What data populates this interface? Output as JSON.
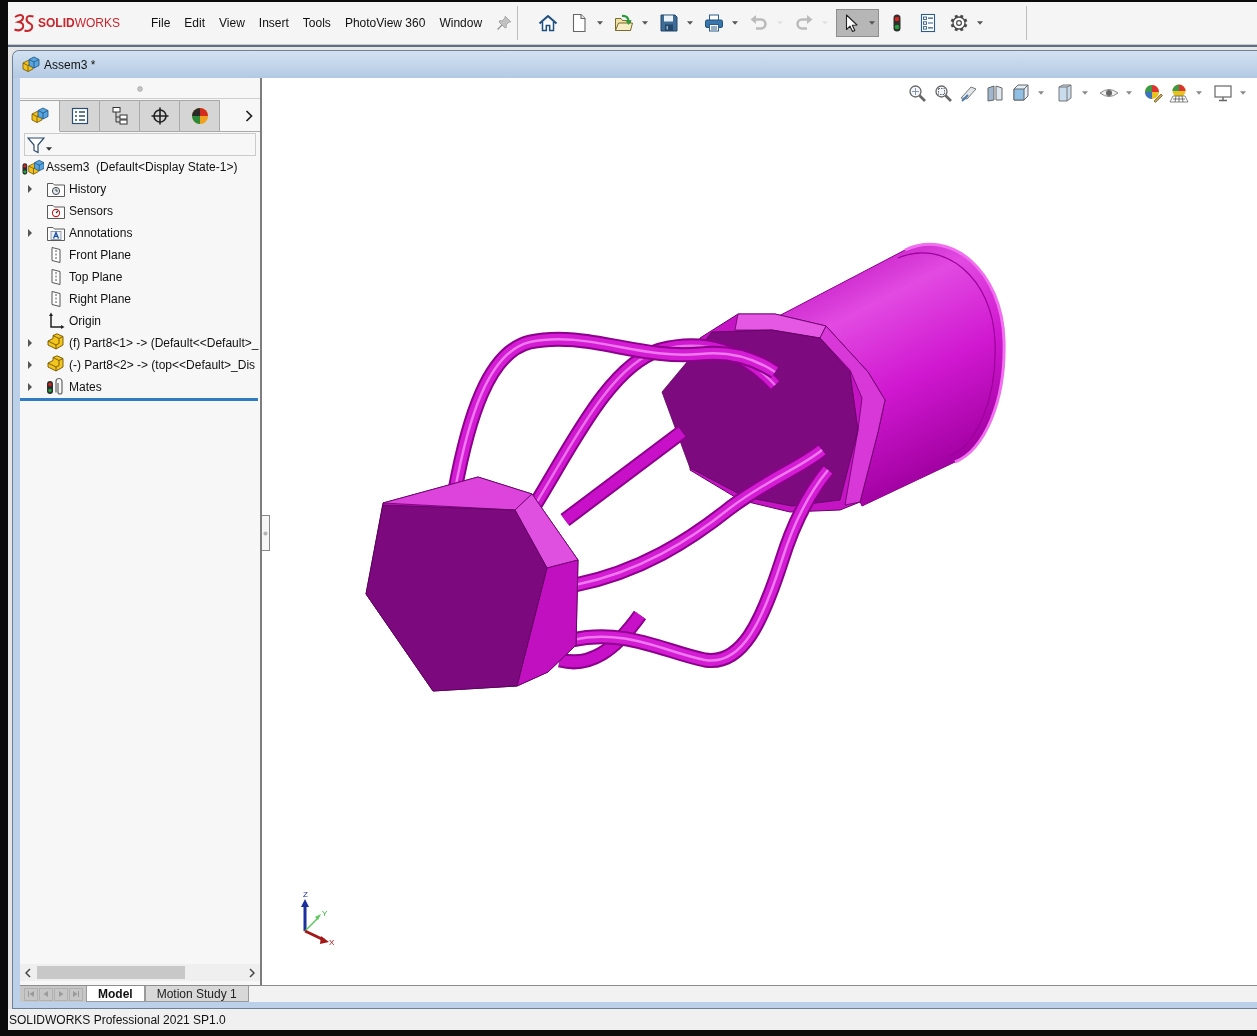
{
  "menubar": {
    "logo": "**SOLID**WORKS",
    "menu": [
      "File",
      "Edit",
      "View",
      "Insert",
      "Tools",
      "PhotoView 360",
      "Window"
    ]
  },
  "toolbar": [
    {
      "dropdown": false,
      "disabled": false,
      "selected": false
    },
    {
      "dropdown": true,
      "disabled": false,
      "selected": false
    },
    {
      "dropdown": true,
      "disabled": false,
      "selected": false
    },
    {
      "dropdown": true,
      "disabled": false,
      "selected": false
    },
    {
      "dropdown": true,
      "disabled": false,
      "selected": false
    },
    {
      "dropdown": true,
      "disabled": true,
      "selected": false
    },
    {
      "dropdown": true,
      "disabled": true,
      "selected": false
    },
    {
      "dropdown": true,
      "disabled": false,
      "selected": true
    },
    {
      "dropdown": false,
      "disabled": false,
      "selected": false
    },
    {
      "dropdown": false,
      "disabled": false,
      "selected": false
    },
    {
      "dropdown": true,
      "disabled": false,
      "selected": false
    }
  ],
  "document": {
    "title": "Assem3 *"
  },
  "feature_panel": {
    "tabs": [
      {
        "selected": true
      },
      {
        "selected": false
      },
      {
        "selected": false
      },
      {
        "selected": false
      },
      {
        "selected": false
      }
    ],
    "tree": {
      "label": "Assem3  (Default<Display State-1>)",
      "kind": "assembly",
      "children": [
        {
          "label": "History",
          "kind": "history",
          "expandable": true,
          "expanded": false
        },
        {
          "label": "Sensors",
          "kind": "sensors",
          "expandable": false
        },
        {
          "label": "Annotations",
          "kind": "annotations",
          "expandable": true,
          "expanded": false
        },
        {
          "label": "Front Plane",
          "kind": "plane",
          "expandable": false
        },
        {
          "label": "Top Plane",
          "kind": "plane",
          "expandable": false
        },
        {
          "label": "Right Plane",
          "kind": "plane",
          "expandable": false
        },
        {
          "label": "Origin",
          "kind": "origin",
          "expandable": false
        },
        {
          "label": "(f) Part8<1> -> (Default<<Default>_",
          "kind": "component",
          "expandable": true,
          "expanded": false
        },
        {
          "label": "(-) Part8<2> -> (top<<Default>_Dis",
          "kind": "component",
          "expandable": true,
          "expanded": false
        },
        {
          "label": "Mates",
          "kind": "mates",
          "expandable": true,
          "expanded": false
        }
      ]
    }
  },
  "view_toolbar": [
    {
      "dropdown": false
    },
    {
      "dropdown": false
    },
    {
      "dropdown": false
    },
    {
      "dropdown": false
    },
    {
      "dropdown": true
    },
    {
      "dropdown": true
    },
    {
      "dropdown": true
    },
    {
      "dropdown": false
    },
    {
      "dropdown": true
    },
    {
      "dropdown": true
    }
  ],
  "viewport": {
    "triad": [
      "Z",
      "Y",
      "X"
    ]
  },
  "bottom_tabs": {
    "navigation": [
      {
        "disabled": true
      },
      {
        "disabled": true
      },
      {
        "disabled": true
      },
      {
        "disabled": true
      }
    ],
    "tabs": [
      {
        "label": "Model",
        "selected": true
      },
      {
        "label": "Motion Study 1",
        "selected": false
      }
    ]
  },
  "status_bar": {
    "text": "SOLIDWORKS Professional 2021 SP1.0"
  }
}
